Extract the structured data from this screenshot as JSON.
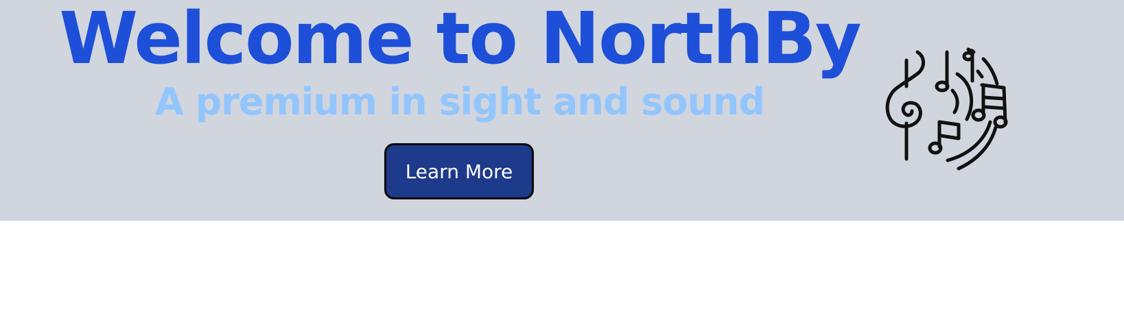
{
  "hero": {
    "title": "Welcome to NorthBy",
    "subtitle": "A premium in sight and sound",
    "cta_label": "Learn More",
    "icon": "music-notes-icon"
  },
  "colors": {
    "hero_background": "#d1d5de",
    "title": "#1d4fd8",
    "subtitle": "#93c5fd",
    "button_background": "#1e3a8a",
    "button_text": "#ffffff",
    "page_background": "#ffffff"
  }
}
